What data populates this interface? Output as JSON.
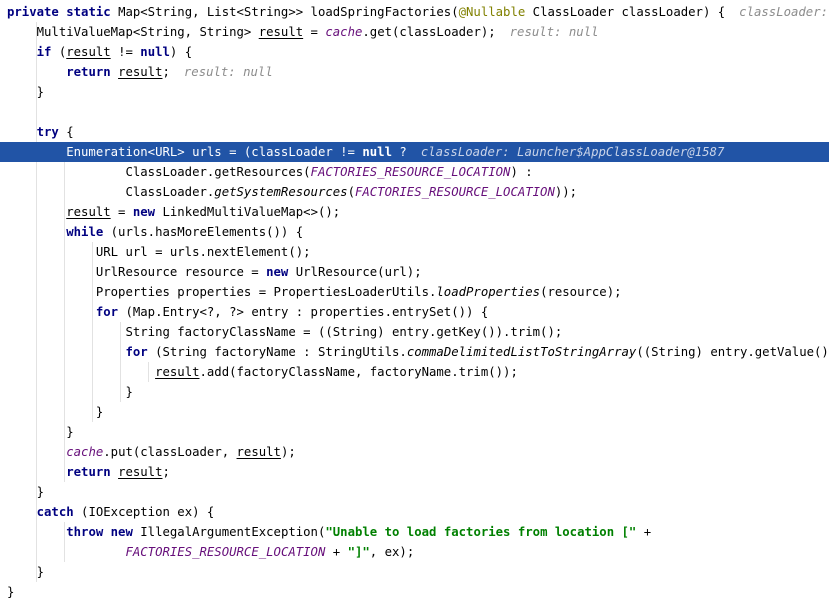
{
  "code_lines": [
    {
      "tokens": [
        {
          "t": "private ",
          "s": "kw"
        },
        {
          "t": "static ",
          "s": "kw"
        },
        {
          "t": "Map<String, List<String>> loadSpringFactories(",
          "s": ""
        },
        {
          "t": "@Nullable ",
          "s": "anno"
        },
        {
          "t": "ClassLoader classLoader) {",
          "s": ""
        }
      ],
      "hint": "classLoader: Launch"
    },
    {
      "tokens": [
        {
          "t": "    MultiValueMap<String, String> ",
          "s": ""
        },
        {
          "t": "result",
          "s": "ul"
        },
        {
          "t": " = ",
          "s": ""
        },
        {
          "t": "cache",
          "s": "const"
        },
        {
          "t": ".get(classLoader);",
          "s": ""
        }
      ],
      "hint": "result: null"
    },
    {
      "tokens": [
        {
          "t": "    ",
          "s": ""
        },
        {
          "t": "if ",
          "s": "kw"
        },
        {
          "t": "(",
          "s": ""
        },
        {
          "t": "result",
          "s": "ul"
        },
        {
          "t": " != ",
          "s": ""
        },
        {
          "t": "null",
          "s": "kw"
        },
        {
          "t": ") {",
          "s": ""
        }
      ],
      "hint": ""
    },
    {
      "tokens": [
        {
          "t": "        ",
          "s": ""
        },
        {
          "t": "return ",
          "s": "kw"
        },
        {
          "t": "result",
          "s": "ul"
        },
        {
          "t": ";",
          "s": ""
        }
      ],
      "hint": "result: null"
    },
    {
      "tokens": [
        {
          "t": "    }",
          "s": ""
        }
      ],
      "hint": ""
    },
    {
      "tokens": [],
      "hint": ""
    },
    {
      "tokens": [
        {
          "t": "    ",
          "s": ""
        },
        {
          "t": "try ",
          "s": "kw"
        },
        {
          "t": "{",
          "s": ""
        }
      ],
      "hint": ""
    },
    {
      "tokens": [
        {
          "t": "        Enumeration<URL> urls = (classLoader != ",
          "s": ""
        },
        {
          "t": "null ",
          "s": "kw"
        },
        {
          "t": "?",
          "s": ""
        }
      ],
      "hint": "classLoader: Launcher$AppClassLoader@1587",
      "highlighted": true
    },
    {
      "tokens": [
        {
          "t": "                ClassLoader.getResources(",
          "s": ""
        },
        {
          "t": "FACTORIES_RESOURCE_LOCATION",
          "s": "const"
        },
        {
          "t": ") :",
          "s": ""
        }
      ],
      "hint": ""
    },
    {
      "tokens": [
        {
          "t": "                ClassLoader.",
          "s": ""
        },
        {
          "t": "getSystemResources",
          "s": "static-m"
        },
        {
          "t": "(",
          "s": ""
        },
        {
          "t": "FACTORIES_RESOURCE_LOCATION",
          "s": "const"
        },
        {
          "t": "));",
          "s": ""
        }
      ],
      "hint": ""
    },
    {
      "tokens": [
        {
          "t": "        ",
          "s": ""
        },
        {
          "t": "result",
          "s": "ul"
        },
        {
          "t": " = ",
          "s": ""
        },
        {
          "t": "new ",
          "s": "kw"
        },
        {
          "t": "LinkedMultiValueMap<>();",
          "s": ""
        }
      ],
      "hint": ""
    },
    {
      "tokens": [
        {
          "t": "        ",
          "s": ""
        },
        {
          "t": "while ",
          "s": "kw"
        },
        {
          "t": "(urls.hasMoreElements()) {",
          "s": ""
        }
      ],
      "hint": ""
    },
    {
      "tokens": [
        {
          "t": "            URL url = urls.nextElement();",
          "s": ""
        }
      ],
      "hint": ""
    },
    {
      "tokens": [
        {
          "t": "            UrlResource resource = ",
          "s": ""
        },
        {
          "t": "new ",
          "s": "kw"
        },
        {
          "t": "UrlResource(url);",
          "s": ""
        }
      ],
      "hint": ""
    },
    {
      "tokens": [
        {
          "t": "            Properties properties = PropertiesLoaderUtils.",
          "s": ""
        },
        {
          "t": "loadProperties",
          "s": "static-m"
        },
        {
          "t": "(resource);",
          "s": ""
        }
      ],
      "hint": ""
    },
    {
      "tokens": [
        {
          "t": "            ",
          "s": ""
        },
        {
          "t": "for ",
          "s": "kw"
        },
        {
          "t": "(Map.Entry<?, ?> entry : properties.entrySet()) {",
          "s": ""
        }
      ],
      "hint": ""
    },
    {
      "tokens": [
        {
          "t": "                String factoryClassName = ((String) entry.getKey()).trim();",
          "s": ""
        }
      ],
      "hint": ""
    },
    {
      "tokens": [
        {
          "t": "                ",
          "s": ""
        },
        {
          "t": "for ",
          "s": "kw"
        },
        {
          "t": "(String factoryName : StringUtils.",
          "s": ""
        },
        {
          "t": "commaDelimitedListToStringArray",
          "s": "static-m"
        },
        {
          "t": "((String) entry.getValue())) {",
          "s": ""
        }
      ],
      "hint": ""
    },
    {
      "tokens": [
        {
          "t": "                    ",
          "s": ""
        },
        {
          "t": "result",
          "s": "ul"
        },
        {
          "t": ".add(factoryClassName, factoryName.trim());",
          "s": ""
        }
      ],
      "hint": ""
    },
    {
      "tokens": [
        {
          "t": "                }",
          "s": ""
        }
      ],
      "hint": ""
    },
    {
      "tokens": [
        {
          "t": "            }",
          "s": ""
        }
      ],
      "hint": ""
    },
    {
      "tokens": [
        {
          "t": "        }",
          "s": ""
        }
      ],
      "hint": ""
    },
    {
      "tokens": [
        {
          "t": "        ",
          "s": ""
        },
        {
          "t": "cache",
          "s": "const"
        },
        {
          "t": ".put(classLoader, ",
          "s": ""
        },
        {
          "t": "result",
          "s": "ul"
        },
        {
          "t": ");",
          "s": ""
        }
      ],
      "hint": ""
    },
    {
      "tokens": [
        {
          "t": "        ",
          "s": ""
        },
        {
          "t": "return ",
          "s": "kw"
        },
        {
          "t": "result",
          "s": "ul"
        },
        {
          "t": ";",
          "s": ""
        }
      ],
      "hint": ""
    },
    {
      "tokens": [
        {
          "t": "    }",
          "s": ""
        }
      ],
      "hint": ""
    },
    {
      "tokens": [
        {
          "t": "    ",
          "s": ""
        },
        {
          "t": "catch ",
          "s": "kw"
        },
        {
          "t": "(IOException ex) {",
          "s": ""
        }
      ],
      "hint": ""
    },
    {
      "tokens": [
        {
          "t": "        ",
          "s": ""
        },
        {
          "t": "throw ",
          "s": "kw"
        },
        {
          "t": "new ",
          "s": "kw"
        },
        {
          "t": "IllegalArgumentException(",
          "s": ""
        },
        {
          "t": "\"Unable to load factories from location [\"",
          "s": "str"
        },
        {
          "t": " +",
          "s": ""
        }
      ],
      "hint": ""
    },
    {
      "tokens": [
        {
          "t": "                ",
          "s": ""
        },
        {
          "t": "FACTORIES_RESOURCE_LOCATION",
          "s": "const"
        },
        {
          "t": " + ",
          "s": ""
        },
        {
          "t": "\"]\"",
          "s": "str"
        },
        {
          "t": ", ex);",
          "s": ""
        }
      ],
      "hint": ""
    },
    {
      "tokens": [
        {
          "t": "    }",
          "s": ""
        }
      ],
      "hint": ""
    },
    {
      "tokens": [
        {
          "t": "}",
          "s": ""
        }
      ],
      "hint": ""
    }
  ],
  "theme": {
    "keyword_color": "#000080",
    "string_color": "#008000",
    "constant_color": "#660e7a",
    "annotation_color": "#808000",
    "hint_color": "#8c8c8c",
    "highlight_bg": "#2154a6"
  }
}
